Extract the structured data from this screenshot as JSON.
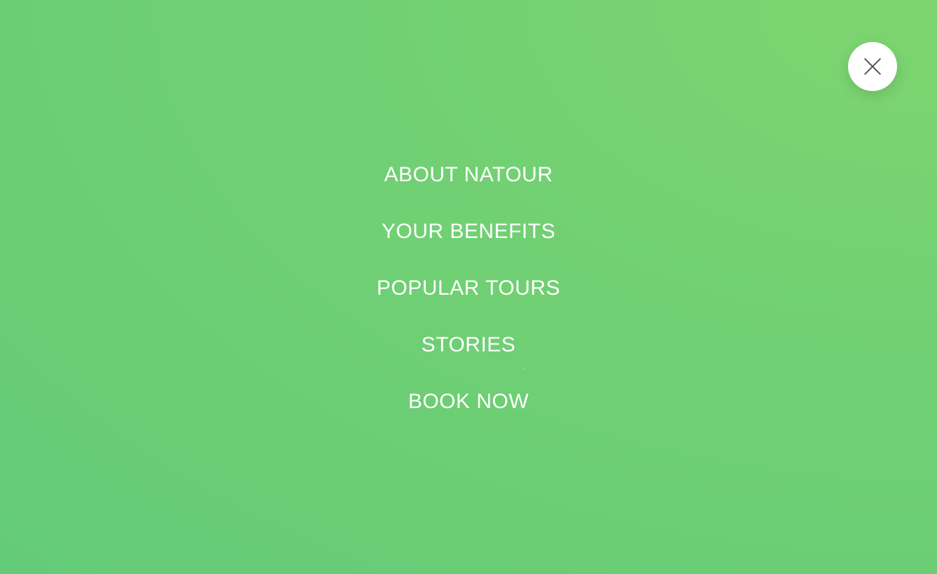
{
  "close_button": {
    "icon": "close-icon",
    "label": ""
  },
  "navigation": {
    "items": [
      {
        "label": "ABOUT NATOUR"
      },
      {
        "label": "YOUR BENEFITS"
      },
      {
        "label": "POPULAR TOURS"
      },
      {
        "label": "STORIES"
      },
      {
        "label": "BOOK NOW"
      }
    ]
  },
  "colors": {
    "background_light": "#7ed56f",
    "background_dark": "#64cb78",
    "nav_text": "#ffffff",
    "close_button_bg": "#ffffff",
    "close_icon": "#555555"
  }
}
